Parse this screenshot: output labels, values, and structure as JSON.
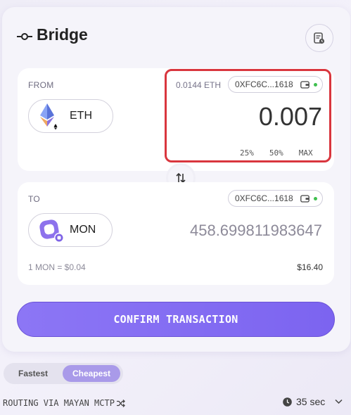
{
  "header": {
    "title": "Bridge",
    "title_icon": "bridge-icon",
    "history_icon": "history-icon"
  },
  "from": {
    "label": "FROM",
    "token": "ETH",
    "balance": "0.0144 ETH",
    "address": "0XFC6C...1618",
    "amount": "0.007",
    "percent_buttons": [
      "25%",
      "50%",
      "MAX"
    ]
  },
  "to": {
    "label": "TO",
    "token": "MON",
    "address": "0XFC6C...1618",
    "amount": "458.699811983647",
    "rate": "1 MON = $0.04",
    "usd_value": "$16.40"
  },
  "confirm_label": "CONFIRM TRANSACTION",
  "route_tabs": {
    "fastest": "Fastest",
    "cheapest": "Cheapest",
    "selected": "Cheapest"
  },
  "routing_text": "ROUTING VIA MAYAN MCTP",
  "eta": "35 sec",
  "colors": {
    "accent": "#7c64f0",
    "highlight": "#d9363e",
    "connected": "#3fbf4e"
  }
}
